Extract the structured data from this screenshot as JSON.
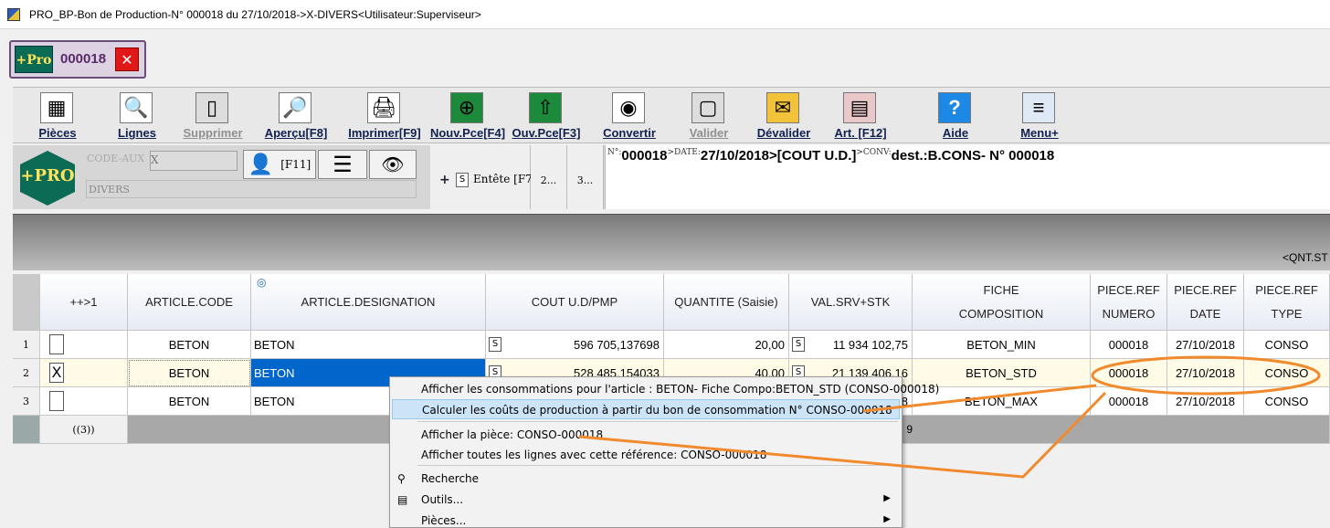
{
  "window": {
    "title": "PRO_BP-Bon de Production-N° 000018 du 27/10/2018->X-DIVERS<Utilisateur:Superviseur>"
  },
  "doc_tab": {
    "logo": "+Pro",
    "number": "000018",
    "close": "✕"
  },
  "toolbar": [
    {
      "label": "Pièces",
      "icon": "grid-icon",
      "disabled": false
    },
    {
      "label": "Lignes",
      "icon": "search-icon",
      "disabled": false
    },
    {
      "label": "Supprimer",
      "icon": "delete-icon",
      "disabled": true
    },
    {
      "label": "Aperçu[F8]",
      "icon": "preview-icon",
      "disabled": false
    },
    {
      "label": "Imprimer[F9]",
      "icon": "printer-icon",
      "disabled": false
    },
    {
      "label": "Nouv.Pce[F4]",
      "icon": "new-piece-icon",
      "disabled": false
    },
    {
      "label": "Ouv.Pce[F3]",
      "icon": "open-piece-icon",
      "disabled": false
    },
    {
      "label": "Convertir",
      "icon": "convert-icon",
      "disabled": false
    },
    {
      "label": "Valider",
      "icon": "validate-icon",
      "disabled": true
    },
    {
      "label": "Dévalider",
      "icon": "unvalidate-icon",
      "disabled": false
    },
    {
      "label": "Art. [F12]",
      "icon": "articles-icon",
      "disabled": false
    },
    {
      "label": "Aide",
      "icon": "help-icon",
      "disabled": false
    },
    {
      "label": "Menu+",
      "icon": "menu-icon",
      "disabled": false
    }
  ],
  "header": {
    "logo": "+PRO",
    "code_aux_label": "CODE-AUX",
    "code_aux_value": "X",
    "divers": "DIVERS",
    "f11": "[F11]",
    "entete_plus": "+",
    "entete_s": "S",
    "entete_label": "Entête [F7]",
    "tab2": "2...",
    "tab3": "3...",
    "info": {
      "n_label": "N°:",
      "n_value": "000018",
      "date_label": ">DATE:",
      "date_value": "27/10/2018",
      "cout": ">[COUT U.D.]",
      "conv_label": ">CONV:",
      "conv_value": "dest.:B.CONS- N° 000018"
    }
  },
  "graybar": {
    "qnt": "<QNT.ST"
  },
  "grid": {
    "headers": [
      {
        "label": "++>1"
      },
      {
        "label": "ARTICLE.CODE"
      },
      {
        "label": "ARTICLE.DESIGNATION"
      },
      {
        "label": "COUT U.D/PMP"
      },
      {
        "label": "QUANTITE (Saisie)"
      },
      {
        "label": "VAL.SRV+STK"
      },
      {
        "label": "FICHE\nCOMPOSITION"
      },
      {
        "label": "PIECE.REF\nNUMERO"
      },
      {
        "label": "PIECE.REF\nDATE"
      },
      {
        "label": "PIECE.REF\nTYPE"
      }
    ],
    "rows": [
      {
        "num": "1",
        "check": "",
        "code": "BETON",
        "designation": "BETON",
        "s1": "S",
        "cout": "596 705,137698",
        "quantite": "20,00",
        "s2": "S",
        "val": "11 934 102,75",
        "fiche": "BETON_MIN",
        "ref_num": "000018",
        "ref_date": "27/10/2018",
        "ref_type": "CONSO"
      },
      {
        "num": "2",
        "check": "X",
        "code": "BETON",
        "designation": "BETON",
        "s1": "S",
        "cout": "528 485,154033",
        "quantite": "40,00",
        "s2": "S",
        "val": "21 139 406,16",
        "fiche": "BETON_STD",
        "ref_num": "000018",
        "ref_date": "27/10/2018",
        "ref_type": "CONSO"
      },
      {
        "num": "3",
        "check": "",
        "code": "BETON",
        "designation": "BETON",
        "s1": "",
        "cout": "",
        "quantite": "",
        "s2": "",
        "val": "8",
        "fiche": "BETON_MAX",
        "ref_num": "000018",
        "ref_date": "27/10/2018",
        "ref_type": "CONSO"
      }
    ],
    "footer": {
      "count": "((3))",
      "val": "9"
    }
  },
  "context_menu": [
    {
      "label": "Afficher les consommations pour l'article : BETON- Fiche Compo:BETON_STD (CONSO-000018)"
    },
    {
      "label": "Calculer les coûts de production à partir du bon de consommation N° CONSO-000018"
    },
    {
      "label": "Afficher la pièce: CONSO-000018"
    },
    {
      "label": "Afficher toutes les lignes avec cette référence: CONSO-000018"
    },
    {
      "label": "Recherche",
      "icon": "binoculars-icon"
    },
    {
      "label": "Outils...",
      "icon": "tools-icon"
    },
    {
      "label": "Pièces..."
    }
  ],
  "colors": {
    "accent": "#0c6b55",
    "highlight": "#0066cc",
    "annotation": "#f08a2c",
    "selected_row": "#fffbe6"
  }
}
